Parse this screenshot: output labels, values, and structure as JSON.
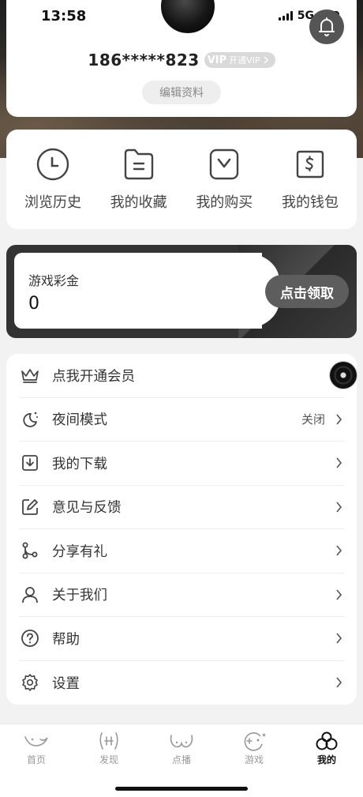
{
  "status_bar": {
    "time": "13:58",
    "network": "5G"
  },
  "profile": {
    "phone": "186*****823",
    "vip_badge_logo": "VIP",
    "vip_badge_text": "开通VIP",
    "edit_label": "编辑资料"
  },
  "shortcuts": [
    {
      "label": "浏览历史",
      "icon": "clock-icon"
    },
    {
      "label": "我的收藏",
      "icon": "folder-icon"
    },
    {
      "label": "我的购买",
      "icon": "bag-icon"
    },
    {
      "label": "我的钱包",
      "icon": "wallet-icon"
    }
  ],
  "game_bonus": {
    "title": "游戏彩金",
    "value": "0",
    "claim_label": "点击领取"
  },
  "menu": [
    {
      "label": "点我开通会员",
      "icon": "crown-icon",
      "status": ""
    },
    {
      "label": "夜间模式",
      "icon": "moon-icon",
      "status": "关闭"
    },
    {
      "label": "我的下载",
      "icon": "download-icon",
      "status": ""
    },
    {
      "label": "意见与反馈",
      "icon": "edit-icon",
      "status": ""
    },
    {
      "label": "分享有礼",
      "icon": "share-icon",
      "status": ""
    },
    {
      "label": "关于我们",
      "icon": "user-icon",
      "status": ""
    },
    {
      "label": "帮助",
      "icon": "help-icon",
      "status": ""
    },
    {
      "label": "设置",
      "icon": "gear-icon",
      "status": ""
    }
  ],
  "tabbar": [
    {
      "label": "首页",
      "icon": "home-tab-icon",
      "active": false
    },
    {
      "label": "发现",
      "icon": "discover-tab-icon",
      "active": false
    },
    {
      "label": "点播",
      "icon": "vod-tab-icon",
      "active": false
    },
    {
      "label": "游戏",
      "icon": "game-tab-icon",
      "active": false
    },
    {
      "label": "我的",
      "icon": "mine-tab-icon",
      "active": true
    }
  ],
  "colors": {
    "accent_dark": "#333333",
    "claim_button": "#5d5d5d",
    "muted_text": "#999999"
  }
}
